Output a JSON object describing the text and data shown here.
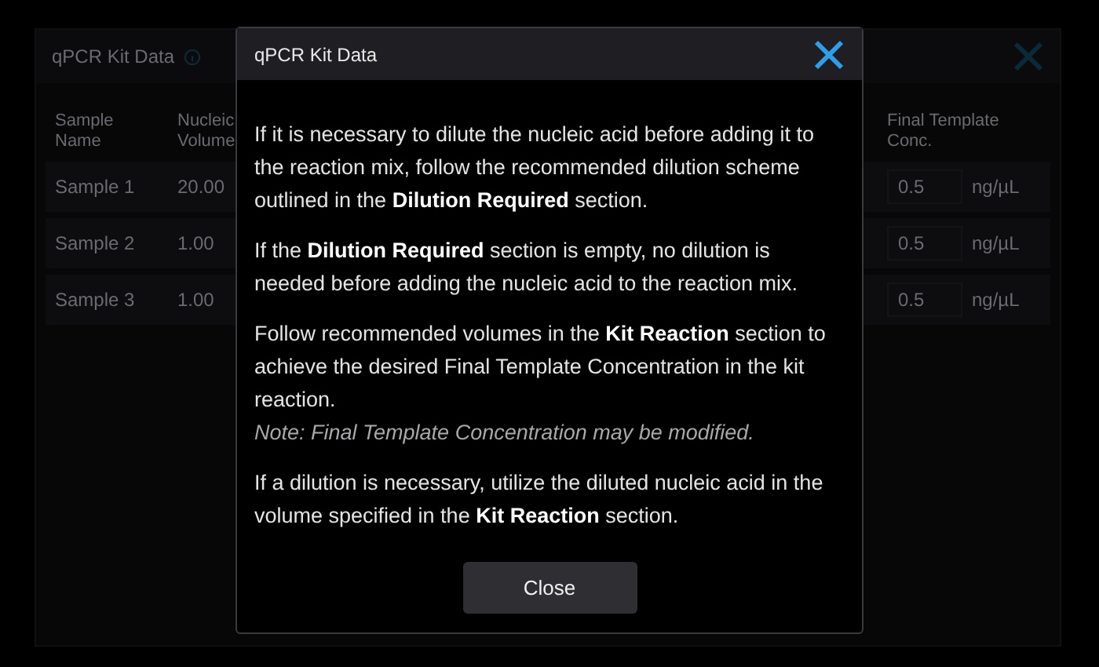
{
  "panel": {
    "title": "qPCR Kit Data",
    "columns": [
      [
        "Sample",
        "Name"
      ],
      [
        "Nucleic",
        "Volume"
      ],
      [
        "Final Template",
        "Conc."
      ]
    ],
    "rows": [
      {
        "name": "Sample 1",
        "volume": "20.00",
        "conc": "0.5",
        "unit": "ng/µL"
      },
      {
        "name": "Sample 2",
        "volume": "1.00",
        "conc": "0.5",
        "unit": "ng/µL"
      },
      {
        "name": "Sample 3",
        "volume": "1.00",
        "conc": "0.5",
        "unit": "ng/µL"
      }
    ]
  },
  "dialog": {
    "title": "qPCR Kit Data",
    "paragraphs": [
      {
        "text": "If it is necessary to dilute the nucleic acid before adding it to the reaction mix, follow the recommended dilution scheme outlined in the **Dilution Required** section."
      },
      {
        "text": "If the **Dilution Required** section is empty, no dilution is needed before adding the nucleic acid to the reaction mix."
      },
      {
        "text": "Follow recommended volumes in the **Kit Reaction** section to achieve the desired Final Template Concentration in the kit reaction.",
        "note": "Note: Final Template Concentration may be modified."
      },
      {
        "text": "If a dilution is necessary, utilize the diluted nucleic acid in the volume specified in the **Kit Reaction** section."
      }
    ],
    "button": "Close"
  }
}
